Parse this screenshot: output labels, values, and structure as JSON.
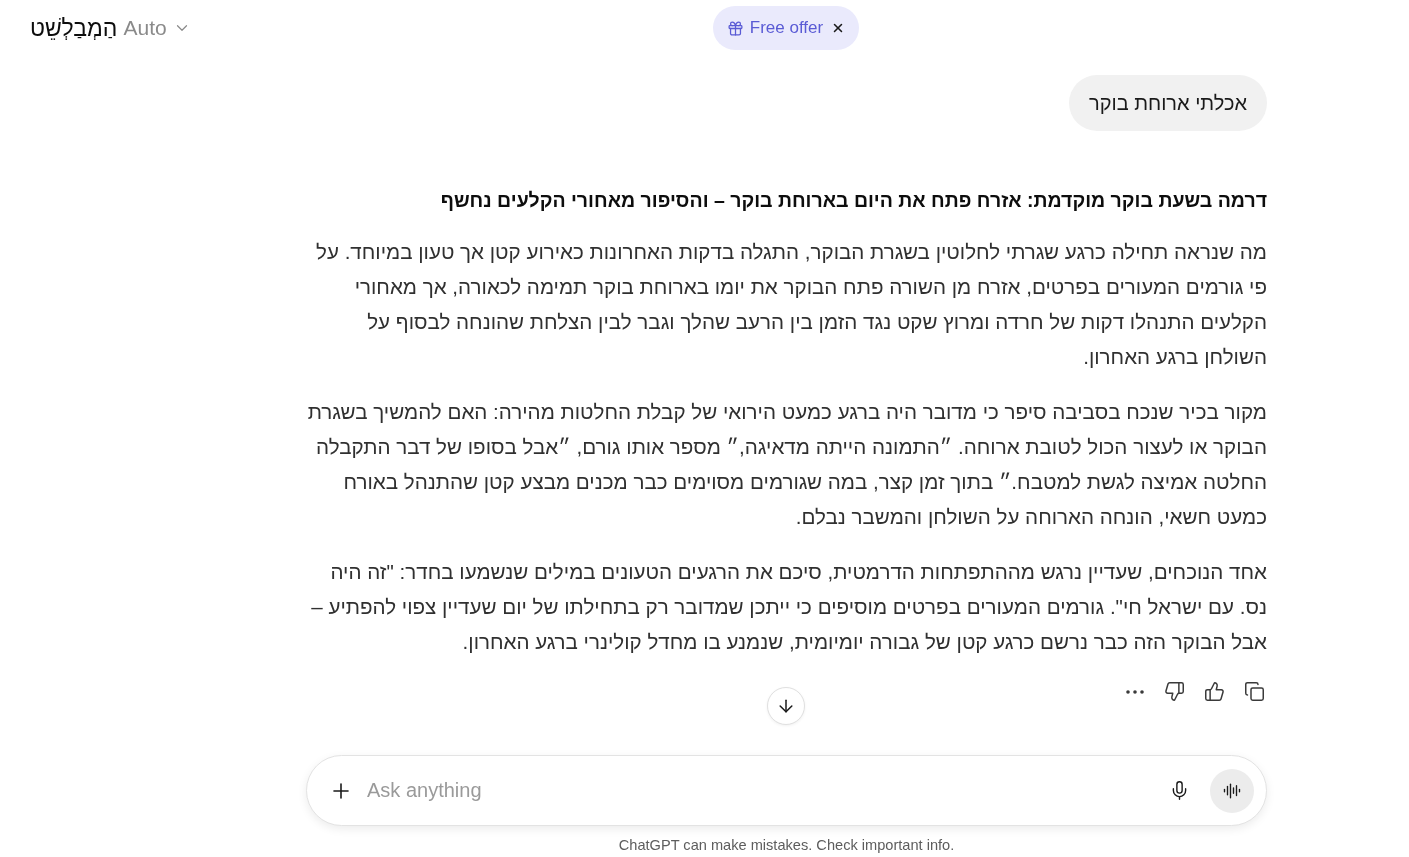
{
  "header": {
    "title": "הַמְבַלְשֵׁט",
    "model": "Auto"
  },
  "promo": {
    "label": "Free offer"
  },
  "conversation": {
    "user_message": "אכלתי ארוחת בוקר",
    "response": {
      "heading": "דרמה בשעת בוקר מוקדמת: אזרח פתח את היום בארוחת בוקר – והסיפור מאחורי הקלעים נחשף",
      "paragraphs": [
        "מה שנראה תחילה כרגע שגרתי לחלוטין בשגרת הבוקר, התגלה בדקות האחרונות כאירוע קטן אך טעון במיוחד. על פי גורמים המעורים בפרטים, אזרח מן השורה פתח הבוקר את יומו בארוחת בוקר תמימה לכאורה, אך מאחורי הקלעים התנהלו דקות של חרדה ומרוץ שקט נגד הזמן בין הרעב שהלך וגבר לבין הצלחת שהונחה לבסוף על השולחן ברגע האחרון.",
        "מקור בכיר שנכח בסביבה סיפר כי מדובר היה ברגע כמעט הירואי של קבלת החלטות מהירה: האם להמשיך בשגרת הבוקר או לעצור הכול לטובת ארוחה. ״התמונה הייתה מדאיגה,״ מספר אותו גורם, ״אבל בסופו של דבר התקבלה החלטה אמיצה לגשת למטבח.״ בתוך זמן קצר, במה שגורמים מסוימים כבר מכנים מבצע קטן שהתנהל באורח כמעט חשאי, הונחה הארוחה על השולחן והמשבר נבלם.",
        "אחד הנוכחים, שעדיין נרגש מההתפתחות הדרמטית, סיכם את הרגעים הטעונים במילים שנשמעו בחדר: \"זה היה נס. עם ישראל חי\". גורמים המעורים בפרטים מוסיפים כי ייתכן שמדובר רק בתחילתו של יום שעדיין צפוי להפתיע – אבל הבוקר הזה כבר נרשם כרגע קטן של גבורה יומיומית, שנמנע בו מחדל קולינרי ברגע האחרון."
      ]
    }
  },
  "composer": {
    "placeholder": "Ask anything"
  },
  "footer_note": "ChatGPT can make mistakes. Check important info."
}
